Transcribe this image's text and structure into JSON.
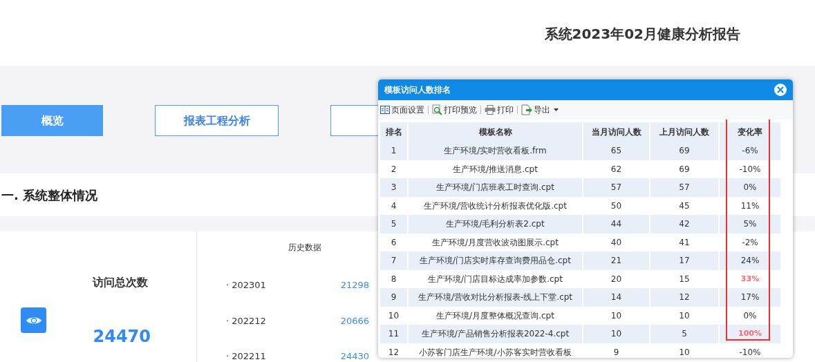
{
  "page_title": "系统2023年02月健康分析报告",
  "tabs": [
    {
      "label": "概览",
      "selected": true
    },
    {
      "label": "报表工程分析",
      "selected": false
    },
    {
      "selected": false
    }
  ],
  "section_heading": "一. 系统整体情况",
  "summary": {
    "label": "访问总次数",
    "value": "24470"
  },
  "history": {
    "title": "历史数据",
    "rows": [
      {
        "month": "· 202301",
        "value": "21298"
      },
      {
        "month": "· 202212",
        "value": "20666"
      },
      {
        "month": "· 202211",
        "value": "24430"
      }
    ]
  },
  "dialog": {
    "title": "模板访问人数排名",
    "toolbar": [
      {
        "kind": "page",
        "label": "页面设置"
      },
      {
        "kind": "preview",
        "label": "打印预览"
      },
      {
        "kind": "print",
        "label": "打印"
      },
      {
        "kind": "export",
        "label": "导出"
      }
    ],
    "columns": [
      "排名",
      "模板名称",
      "当月访问人数",
      "上月访问人数",
      "变化率"
    ],
    "rows": [
      {
        "rank": "1",
        "name": "生产环境/实时营收看板.frm",
        "current": "65",
        "previous": "69",
        "change": "-6%",
        "highlight": false
      },
      {
        "rank": "2",
        "name": "生产环境/推送消息.cpt",
        "current": "62",
        "previous": "69",
        "change": "-10%",
        "highlight": false
      },
      {
        "rank": "3",
        "name": "生产环境/门店班表工时查询.cpt",
        "current": "57",
        "previous": "57",
        "change": "0%",
        "highlight": false
      },
      {
        "rank": "4",
        "name": "生产环境/营收统计分析报表优化版.cpt",
        "current": "50",
        "previous": "45",
        "change": "11%",
        "highlight": false
      },
      {
        "rank": "5",
        "name": "生产环境/毛利分析表2.cpt",
        "current": "44",
        "previous": "42",
        "change": "5%",
        "highlight": false
      },
      {
        "rank": "6",
        "name": "生产环境/月度营收波动图展示.cpt",
        "current": "40",
        "previous": "41",
        "change": "-2%",
        "highlight": false
      },
      {
        "rank": "7",
        "name": "生产环境/门店实时库存查询费用品仓.cpt",
        "current": "21",
        "previous": "17",
        "change": "24%",
        "highlight": false
      },
      {
        "rank": "8",
        "name": "生产环境/门店目标达成率加参数.cpt",
        "current": "20",
        "previous": "15",
        "change": "33%",
        "highlight": true
      },
      {
        "rank": "9",
        "name": "生产环境/营收对比分析报表-线上下堂.cpt",
        "current": "14",
        "previous": "12",
        "change": "17%",
        "highlight": false
      },
      {
        "rank": "10",
        "name": "生产环境/月度整体概况查询.cpt",
        "current": "10",
        "previous": "10",
        "change": "0%",
        "highlight": false
      },
      {
        "rank": "11",
        "name": "生产环境/产品销售分析报表2022-4.cpt",
        "current": "10",
        "previous": "5",
        "change": "100%",
        "highlight": true
      },
      {
        "rank": "12",
        "name": "小苏客门店生产环境/小苏客实时营收看板",
        "current": "9",
        "previous": "10",
        "change": "-10%",
        "highlight": false
      }
    ]
  }
}
